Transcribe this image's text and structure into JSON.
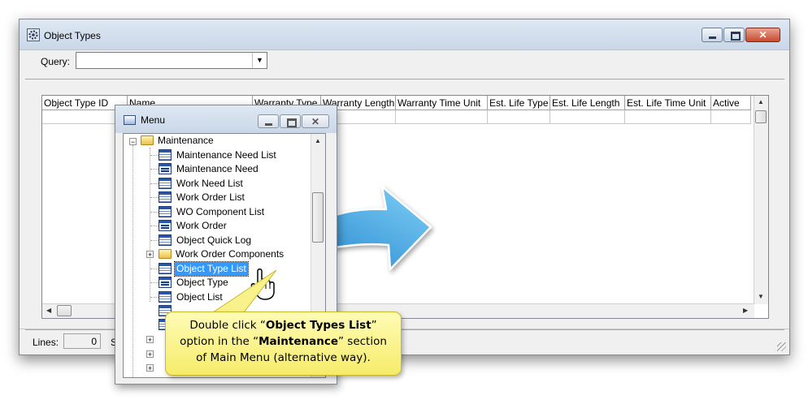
{
  "window": {
    "title": "Object Types",
    "minimize_icon": "minimize-icon",
    "maximize_icon": "maximize-icon",
    "close_icon": "close-icon"
  },
  "query": {
    "label": "Query:",
    "value": ""
  },
  "grid": {
    "columns": [
      {
        "label": "Object Type ID"
      },
      {
        "label": "Name"
      },
      {
        "label": "Warranty Type"
      },
      {
        "label": "Warranty Length"
      },
      {
        "label": "Warranty Time Unit"
      },
      {
        "label": "Est. Life Type"
      },
      {
        "label": "Est. Life Length"
      },
      {
        "label": "Est. Life Time Unit"
      },
      {
        "label": "Active"
      }
    ]
  },
  "status": {
    "lines_label": "Lines:",
    "lines_value": "0",
    "truncated_text": "S"
  },
  "menu": {
    "title": "Menu",
    "root": {
      "label": "Maintenance",
      "icon": "folder-open-icon"
    },
    "items": [
      {
        "label": "Maintenance Need List",
        "icon": "list-icon"
      },
      {
        "label": "Maintenance Need",
        "icon": "form-icon"
      },
      {
        "label": "Work Need List",
        "icon": "list-icon"
      },
      {
        "label": "Work Order List",
        "icon": "list-icon"
      },
      {
        "label": "WO Component List",
        "icon": "list-icon"
      },
      {
        "label": "Work Order",
        "icon": "form-icon"
      },
      {
        "label": "Object Quick Log",
        "icon": "list-icon"
      },
      {
        "label": "Work Order Components",
        "icon": "folder-icon"
      },
      {
        "label": "Object Type List",
        "icon": "list-icon"
      },
      {
        "label": "Object Type",
        "icon": "form-icon"
      },
      {
        "label": "Object List",
        "icon": "list-icon"
      }
    ],
    "selected": "Object Type List"
  },
  "callout": {
    "t1": "Double click “",
    "b1": "Object Types List",
    "t2": "”",
    "t3": "option in the “",
    "b2": "Maintenance",
    "t4": "” section",
    "t5": "of Main Menu (alternative way)."
  },
  "colors": {
    "arrow": "#3fa9e6",
    "callout": "#f6ec6a",
    "selection": "#3399ff"
  }
}
